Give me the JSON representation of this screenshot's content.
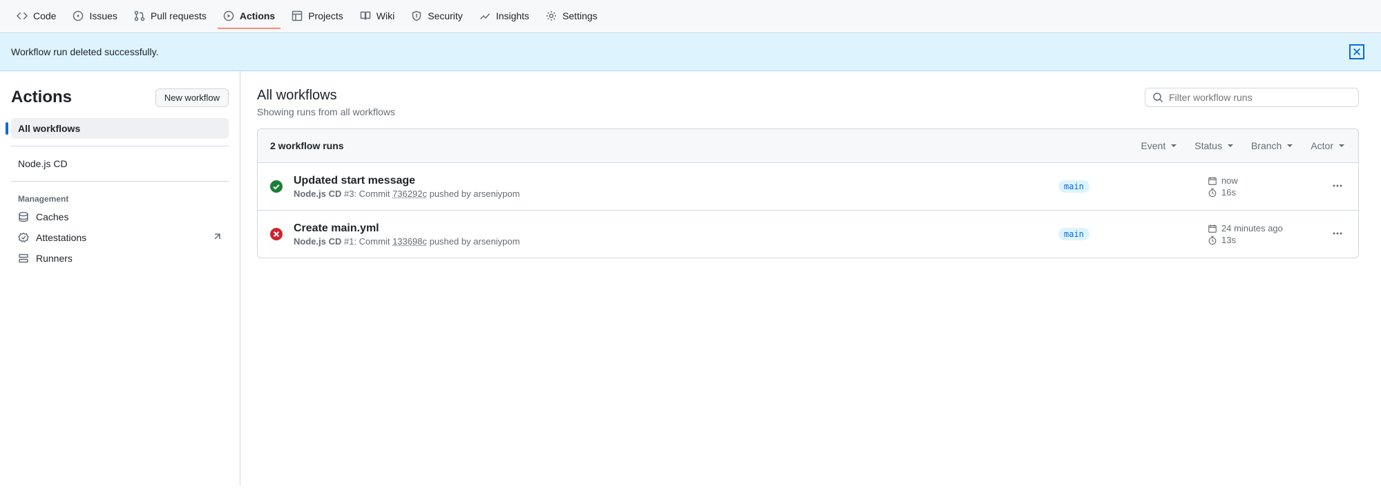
{
  "nav": {
    "items": [
      {
        "label": "Code",
        "icon": "code"
      },
      {
        "label": "Issues",
        "icon": "issue"
      },
      {
        "label": "Pull requests",
        "icon": "git-pull"
      },
      {
        "label": "Actions",
        "icon": "play"
      },
      {
        "label": "Projects",
        "icon": "project"
      },
      {
        "label": "Wiki",
        "icon": "book"
      },
      {
        "label": "Security",
        "icon": "shield"
      },
      {
        "label": "Insights",
        "icon": "graph"
      },
      {
        "label": "Settings",
        "icon": "gear"
      }
    ],
    "active_index": 3
  },
  "flash": {
    "message": "Workflow run deleted successfully."
  },
  "sidebar": {
    "title": "Actions",
    "new_workflow_label": "New workflow",
    "all_workflows_label": "All workflows",
    "workflows": [
      {
        "label": "Node.js CD"
      }
    ],
    "management_heading": "Management",
    "management": [
      {
        "label": "Caches",
        "icon": "caches"
      },
      {
        "label": "Attestations",
        "icon": "attest",
        "external": true
      },
      {
        "label": "Runners",
        "icon": "runners"
      }
    ]
  },
  "main": {
    "title": "All workflows",
    "subtitle": "Showing runs from all workflows",
    "search_placeholder": "Filter workflow runs",
    "runs_count_label": "2 workflow runs",
    "filters": [
      {
        "label": "Event"
      },
      {
        "label": "Status"
      },
      {
        "label": "Branch"
      },
      {
        "label": "Actor"
      }
    ],
    "runs": [
      {
        "status": "success",
        "title": "Updated start message",
        "workflow": "Node.js CD",
        "run_number": "#3",
        "commit_prefix": "Commit",
        "commit": "736292c",
        "pushed_by_prefix": "pushed by",
        "actor": "arseniypom",
        "branch": "main",
        "time_rel": "now",
        "duration": "16s"
      },
      {
        "status": "failure",
        "title": "Create main.yml",
        "workflow": "Node.js CD",
        "run_number": "#1",
        "commit_prefix": "Commit",
        "commit": "133698c",
        "pushed_by_prefix": "pushed by",
        "actor": "arseniypom",
        "branch": "main",
        "time_rel": "24 minutes ago",
        "duration": "13s"
      }
    ]
  }
}
